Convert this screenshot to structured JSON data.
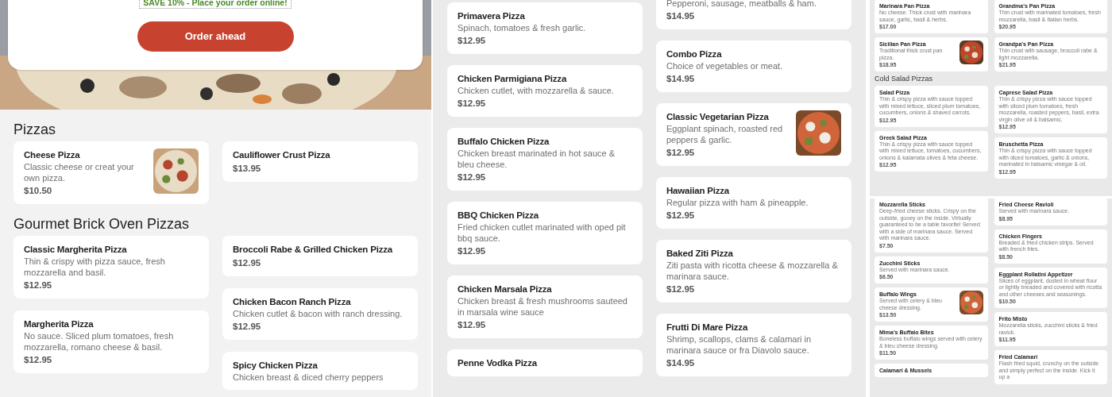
{
  "left_page": {
    "promo": "SAVE 10% - Place your order online!",
    "order_button": "Order ahead",
    "sections": [
      {
        "heading": "Pizzas",
        "columns": [
          [
            {
              "name": "Cheese Pizza",
              "description": "Classic cheese or creat your own pizza.",
              "price": "$10.50",
              "photo": true
            }
          ],
          [
            {
              "name": "Cauliflower Crust Pizza",
              "price": "$13.95",
              "photo": false
            }
          ]
        ]
      },
      {
        "heading": "Gourmet Brick Oven Pizzas",
        "columns": [
          [
            {
              "name": "Classic Margherita Pizza",
              "description": "Thin & crispy with pizza sauce, fresh mozzarella and basil.",
              "price": "$12.95",
              "photo": false
            },
            {
              "name": "Margherita Pizza",
              "description": "No sauce. Sliced plum tomatoes, fresh mozzarella, romano cheese & basil.",
              "price": "$12.95",
              "photo": false
            }
          ],
          [
            {
              "name": "Broccoli Rabe & Grilled Chicken Pizza",
              "price": "$12.95",
              "photo": false
            },
            {
              "name": "Chicken Bacon Ranch Pizza",
              "description": "Chicken cutlet & bacon with ranch dressing.",
              "price": "$12.95",
              "photo": false
            },
            {
              "name": "Spicy Chicken Pizza",
              "description": "Chicken breast & diced cherry peppers",
              "photo": false
            }
          ]
        ]
      }
    ]
  },
  "middle_page": {
    "columns": [
      [
        {
          "name": "Primavera Pizza",
          "description": "Spinach, tomatoes & fresh garlic.",
          "price": "$12.95",
          "photo": false
        },
        {
          "name": "Chicken Parmigiana Pizza",
          "description": "Chicken cutlet, with mozzarella & sauce.",
          "price": "$12.95",
          "photo": false
        },
        {
          "name": "Buffalo Chicken Pizza",
          "description": "Chicken breast marinated in hot sauce & bleu cheese.",
          "price": "$12.95",
          "photo": false
        },
        {
          "name": "BBQ Chicken Pizza",
          "description": "Fried chicken cutlet marinated with oped pit bbq sauce.",
          "price": "$12.95",
          "photo": false
        },
        {
          "name": "Chicken Marsala Pizza",
          "description": "Chicken breast & fresh mushrooms sauteed in marsala wine sauce",
          "price": "$12.95",
          "photo": false
        },
        {
          "name": "Penne Vodka Pizza",
          "photo": false
        }
      ],
      [
        {
          "description": "Pepperoni, sausage, meatballs & ham.",
          "price": "$14.95",
          "photo": false
        },
        {
          "name": "Combo Pizza",
          "description": "Choice of vegetables or meat.",
          "price": "$14.95",
          "photo": false
        },
        {
          "name": "Classic Vegetarian Pizza",
          "description": "Eggplant spinach, roasted red peppers & garlic.",
          "price": "$12.95",
          "photo": true
        },
        {
          "name": "Hawaiian Pizza",
          "description": "Regular pizza with ham & pineapple.",
          "price": "$12.95",
          "photo": false
        },
        {
          "name": "Baked Ziti Pizza",
          "description": "Ziti pasta with ricotta cheese & mozzarella & marinara sauce.",
          "price": "$12.95",
          "photo": false
        },
        {
          "name": "Frutti Di Mare Pizza",
          "description": "Shrimp, scallops, clams & calamari in marinara sauce or fra Diavolo sauce.",
          "price": "$14.95",
          "photo": false
        }
      ]
    ]
  },
  "right_page": {
    "pan_pizzas": [
      [
        {
          "name": "Marinara Pan Pizza",
          "description": "No cheese. Thick crust with marinara sauce, garlic, basil & herbs.",
          "price": "$17.00",
          "photo": false
        },
        {
          "name": "Sicilian Pan Pizza",
          "description": "Traditional thick crust pan pizza.",
          "price": "$18.95",
          "photo": true
        }
      ],
      [
        {
          "name": "Grandma's Pan Pizza",
          "description": "Thin crust with marinated tomatoes, fresh mozzarella, basil & Italian herbs.",
          "price": "$20.95",
          "photo": false
        },
        {
          "name": "Grandpa's Pan Pizza",
          "description": "Thin crust with sausage, broccoli rabe & light mozzarella.",
          "price": "$21.95",
          "photo": false
        }
      ]
    ],
    "cold_heading": "Cold Salad Pizzas",
    "cold_salad": [
      [
        {
          "name": "Salad Pizza",
          "description": "Thin & crispy pizza with sauce topped with mixed lettuce, sliced plum tomatoes, cucumbers, onions & shaved carrots.",
          "price": "$12.95",
          "photo": false
        },
        {
          "name": "Greek Salad Pizza",
          "description": "Thin & crispy pizza with sauce topped with mixed lettuce, tomatoes, cucumbers, onions & kalamata olives & feta cheese.",
          "price": "$12.95",
          "photo": false
        }
      ],
      [
        {
          "name": "Caprese Salad Pizza",
          "description": "Thin & crispy pizza with sauce topped with sliced plum tomatoes, fresh mozzarella, roasted peppers, basil, extra virgin olive oil & balsamic.",
          "price": "$12.95",
          "photo": false
        },
        {
          "name": "Bruschetta Pizza",
          "description": "Thin & crispy pizza with sauce topped with diced tomatoes, garlic & onions, marinated in balsamic vinegar & oil.",
          "price": "$12.95",
          "photo": false
        }
      ]
    ],
    "appetizers": [
      [
        {
          "name": "Mozzarella Sticks",
          "description": "Deep-fried cheese sticks. Crispy on the outside, gooey on the inside. Virtually guaranteed to be a table favorite! Served with a side of marinara sauce. Served with marinara sauce.",
          "price": "$7.50",
          "photo": false
        },
        {
          "name": "Zucchini Sticks",
          "description": "Served with marinara sauce.",
          "price": "$6.50",
          "photo": false
        },
        {
          "name": "Buffalo Wings",
          "description": "Served with celery & bleu cheese dressing.",
          "price": "$13.50",
          "photo": true
        },
        {
          "name": "Mima's Buffalo Bites",
          "description": "Boneless buffalo wings served with celery & bleu cheese dressing.",
          "price": "$11.50",
          "photo": false
        },
        {
          "name": "Calamari & Mussels",
          "photo": false
        }
      ],
      [
        {
          "name": "Fried Cheese Ravioli",
          "description": "Served with marinara sauce.",
          "price": "$8.95",
          "photo": false
        },
        {
          "name": "Chicken Fingers",
          "description": "Breaded & fried chicken strips. Served with french fries.",
          "price": "$8.50",
          "photo": false
        },
        {
          "name": "Eggplant Rollatini Appetizer",
          "description": "Slices of eggplant, dusted in wheat flour or lightly breaded and covered with ricotta and other cheeses and seasonings.",
          "price": "$10.50",
          "photo": false
        },
        {
          "name": "Frito Misto",
          "description": "Mozzarella sticks, zucchini sticks & fried ravioli.",
          "price": "$11.95",
          "photo": false
        },
        {
          "name": "Fried Calamari",
          "description": "Flash fried squid, crunchy on the outside and simply perfect on the inside. Kick it up a",
          "photo": false
        }
      ]
    ]
  }
}
